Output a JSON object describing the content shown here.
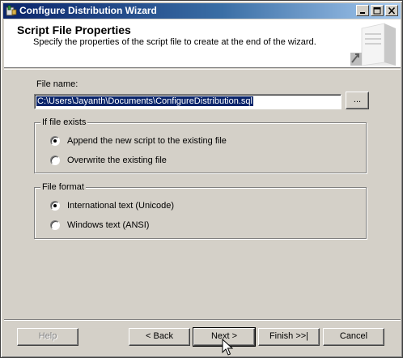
{
  "window": {
    "title": "Configure Distribution Wizard",
    "minimize_icon": "minimize-icon",
    "maximize_icon": "maximize-icon",
    "close_icon": "close-icon"
  },
  "header": {
    "title": "Script File Properties",
    "subtitle": "Specify the properties of the script file to create at the end of the wizard."
  },
  "file": {
    "label": "File name:",
    "value": "C:\\Users\\Jayanth\\Documents\\ConfigureDistribution.sql",
    "browse_label": "..."
  },
  "if_exists": {
    "legend": "If file exists",
    "options": [
      {
        "label": "Append the new script to the existing file",
        "selected": true
      },
      {
        "label": "Overwrite the existing file",
        "selected": false
      }
    ]
  },
  "file_format": {
    "legend": "File format",
    "options": [
      {
        "label": "International text (Unicode)",
        "selected": true
      },
      {
        "label": "Windows text (ANSI)",
        "selected": false
      }
    ]
  },
  "buttons": {
    "help": "Help",
    "back": "< Back",
    "next": "Next >",
    "finish": "Finish >>|",
    "cancel": "Cancel"
  }
}
